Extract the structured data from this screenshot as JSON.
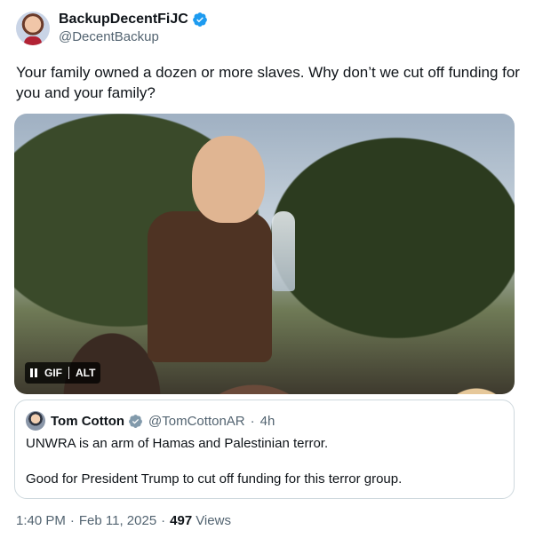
{
  "author": {
    "display_name": "BackupDecentFiJC",
    "handle": "@DecentBackup",
    "verified_color": "#1d9bf0"
  },
  "tweet": {
    "text": "Your family owned a dozen or more slaves. Why don’t we cut off funding for you and your family?"
  },
  "media": {
    "gif_label": "GIF",
    "alt_label": "ALT",
    "controls_icon": "pause-icon"
  },
  "quote": {
    "display_name": "Tom Cotton",
    "handle": "@TomCottonAR",
    "separator": "·",
    "time": "4h",
    "line1": "UNWRA is an arm of Hamas and Palestinian terror.",
    "line2": "Good for President Trump to cut off funding for this terror group.",
    "verified_color": "#829aab"
  },
  "meta": {
    "time": "1:40 PM",
    "sep1": "·",
    "date": "Feb 11, 2025",
    "sep2": "·",
    "views_count": "497",
    "views_label": "Views"
  }
}
